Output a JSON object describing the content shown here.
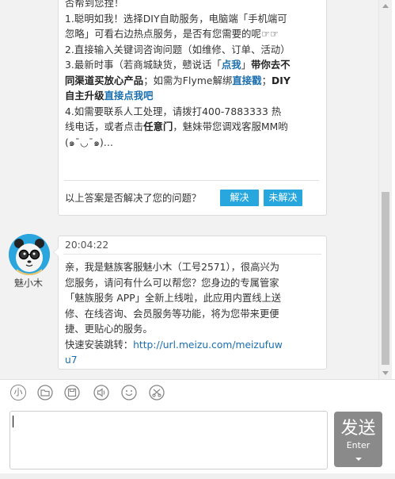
{
  "faq_message": {
    "lines": [
      [
        "否帮到您捏！"
      ],
      [
        "1.聪明如我！选择DIY自助服务，电脑端「手机端可"
      ],
      [
        "忽略」可看右边热点服务，是否有您需要的呢☞☞"
      ],
      [
        "2.直接输入关键词咨询问题（如维修、订单、活动）"
      ],
      [
        "3.最新时事（若商城缺货，戆说话「",
        "点我",
        "」",
        "带你去不"
      ],
      [
        "同渠道买放心产品",
        "；如需为Flyme解绑",
        "直接戳",
        "；",
        "DIY"
      ],
      [
        "自主升级",
        "直接点我吧"
      ],
      [
        "4.如需要联系人工处理，请拨打400-7883333 热"
      ],
      [
        "线电话，或者点击",
        "任意门",
        "，魅妹带您调戏客服MM哟"
      ],
      [
        "(๑¯◡¯๑)..."
      ]
    ],
    "question": "以上答案是否解决了您的问题？",
    "solved_label": "解决",
    "unsolved_label": "未解决"
  },
  "agent": {
    "name": "魅小木",
    "timestamp": "20:04:22",
    "lines": [
      "亲，我是魅族客服魅小木（工号2571），很高兴为",
      "您服务，请问有什么可以帮您？您身边的专属管家",
      "「魅族服务 APP」全新上线啦，此应用内置线上送",
      "修、在线咨询、会员服务等功能，将为您带来更便",
      "捷、更贴心的服务。"
    ],
    "link_prefix": "快速安装跳转：",
    "link_line1": "http://url.meizu.com/meizufuw",
    "link_line2": "u7"
  },
  "toolbar": {
    "icons": [
      "emoji-icon",
      "folder-icon",
      "save-icon",
      "volume-icon",
      "smiley-icon",
      "scissors-icon"
    ],
    "emoji_glyph": "小"
  },
  "composer": {
    "input_value": "",
    "send_label": "发送",
    "send_sub": "Enter"
  }
}
